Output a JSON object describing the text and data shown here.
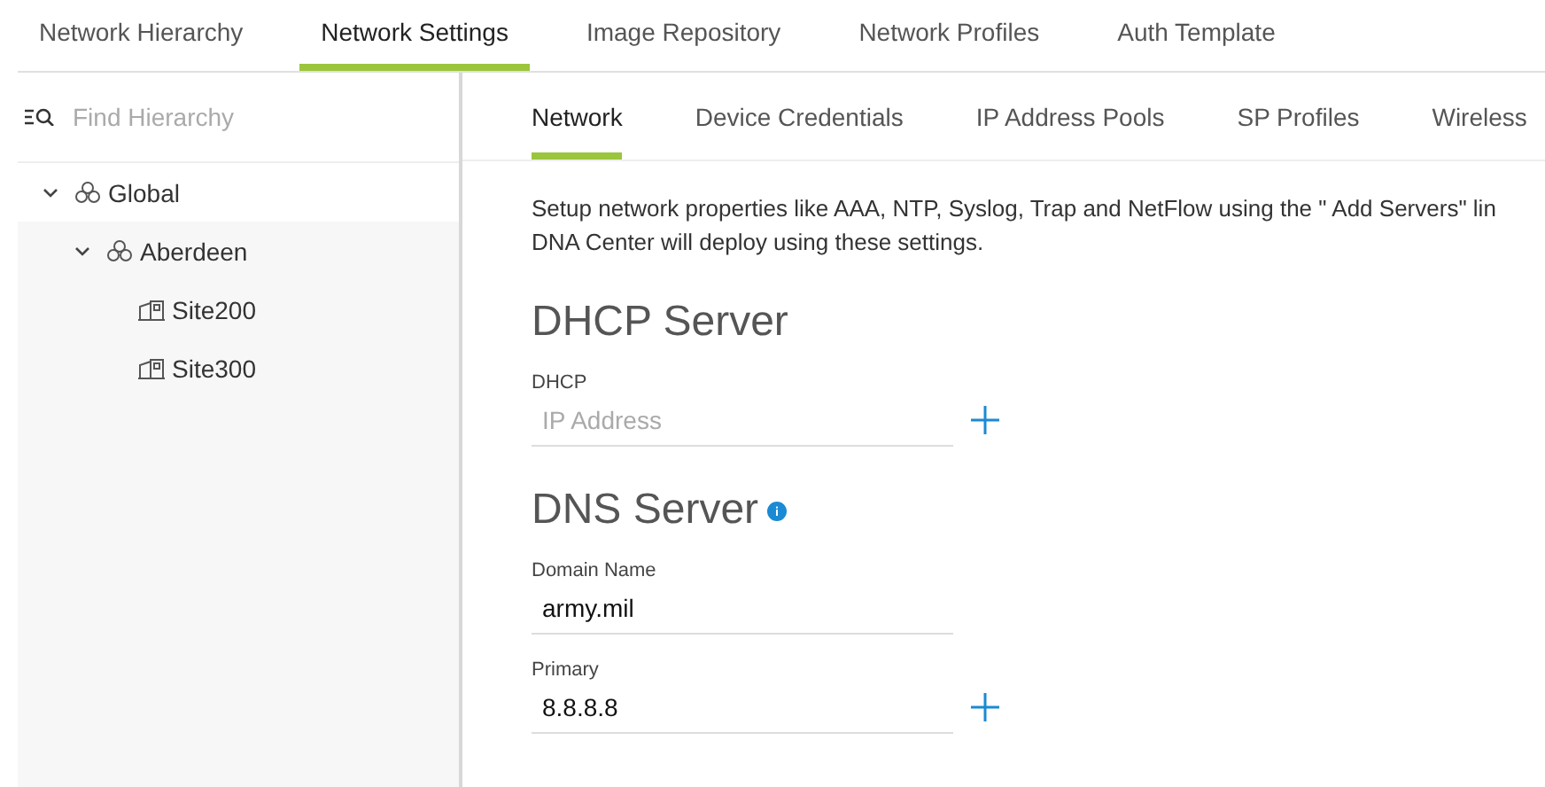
{
  "tabs": [
    {
      "label": "Network Hierarchy",
      "selected": false
    },
    {
      "label": "Network Settings",
      "selected": true
    },
    {
      "label": "Image Repository",
      "selected": false
    },
    {
      "label": "Network Profiles",
      "selected": false
    },
    {
      "label": "Auth Template",
      "selected": false
    }
  ],
  "sidebar": {
    "search": {
      "placeholder": "Find Hierarchy"
    },
    "tree": [
      {
        "label": "Global",
        "kind": "area",
        "expanded": true,
        "children": [
          {
            "label": "Aberdeen",
            "kind": "area",
            "expanded": true,
            "children": [
              {
                "label": "Site200",
                "kind": "building"
              },
              {
                "label": "Site300",
                "kind": "building"
              }
            ]
          }
        ]
      }
    ]
  },
  "subtabs": [
    {
      "label": "Network",
      "selected": true
    },
    {
      "label": "Device Credentials",
      "selected": false
    },
    {
      "label": "IP Address Pools",
      "selected": false
    },
    {
      "label": "SP Profiles",
      "selected": false
    },
    {
      "label": "Wireless",
      "selected": false
    }
  ],
  "description_lines": [
    "Setup network properties like AAA, NTP, Syslog, Trap and NetFlow using the \" Add Servers\"  lin",
    "DNA Center will deploy using these settings."
  ],
  "sections": [
    {
      "title": "DHCP Server",
      "fields": [
        {
          "label": "DHCP",
          "placeholder": "IP Address",
          "addable": true
        }
      ]
    },
    {
      "title": "DNS Server",
      "info": true,
      "fields": [
        {
          "label": "Domain Name",
          "value": "army.mil"
        },
        {
          "label": "Primary",
          "value": "8.8.8.8",
          "addable": true
        }
      ]
    }
  ]
}
